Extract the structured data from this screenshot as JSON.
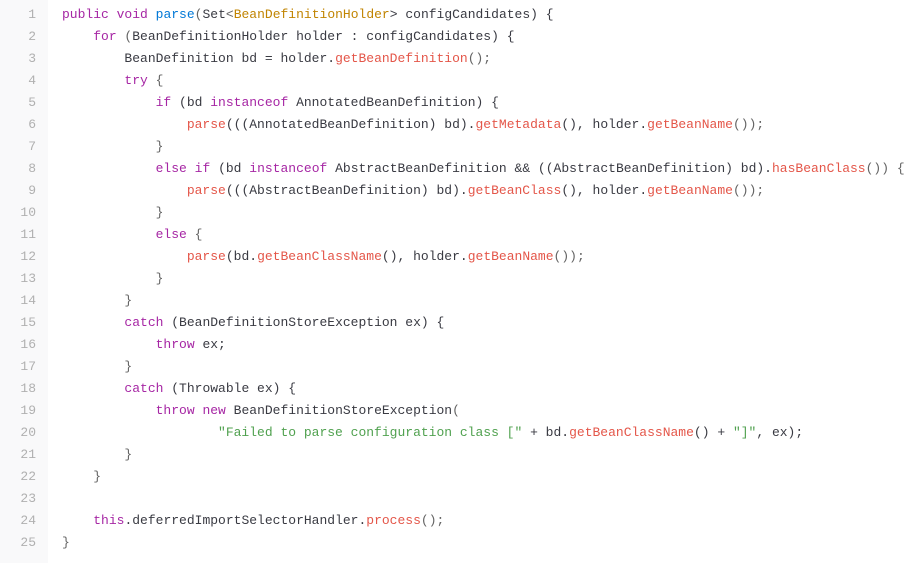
{
  "lines": [
    {
      "n": "1",
      "tokens": [
        {
          "t": "public",
          "c": "kw"
        },
        {
          "t": " ",
          "c": "punc"
        },
        {
          "t": "void",
          "c": "kw"
        },
        {
          "t": " ",
          "c": "punc"
        },
        {
          "t": "parse",
          "c": "method"
        },
        {
          "t": "(",
          "c": "punc"
        },
        {
          "t": "Set",
          "c": "var"
        },
        {
          "t": "<",
          "c": "punc"
        },
        {
          "t": "BeanDefinitionHolder",
          "c": "type"
        },
        {
          "t": "> configCandidates) {",
          "c": "var"
        }
      ]
    },
    {
      "n": "2",
      "tokens": [
        {
          "t": "    ",
          "c": "punc"
        },
        {
          "t": "for",
          "c": "kw"
        },
        {
          "t": " (",
          "c": "punc"
        },
        {
          "t": "BeanDefinitionHolder",
          "c": "var"
        },
        {
          "t": " holder : configCandidates) {",
          "c": "var"
        }
      ]
    },
    {
      "n": "3",
      "tokens": [
        {
          "t": "        ",
          "c": "punc"
        },
        {
          "t": "BeanDefinition",
          "c": "var"
        },
        {
          "t": " bd = holder.",
          "c": "var"
        },
        {
          "t": "getBeanDefinition",
          "c": "call"
        },
        {
          "t": "();",
          "c": "punc"
        }
      ]
    },
    {
      "n": "4",
      "tokens": [
        {
          "t": "        ",
          "c": "punc"
        },
        {
          "t": "try",
          "c": "kw"
        },
        {
          "t": " {",
          "c": "punc"
        }
      ]
    },
    {
      "n": "5",
      "tokens": [
        {
          "t": "            ",
          "c": "punc"
        },
        {
          "t": "if",
          "c": "kw"
        },
        {
          "t": " (bd ",
          "c": "var"
        },
        {
          "t": "instanceof",
          "c": "kw"
        },
        {
          "t": " AnnotatedBeanDefinition) {",
          "c": "var"
        }
      ]
    },
    {
      "n": "6",
      "tokens": [
        {
          "t": "                ",
          "c": "punc"
        },
        {
          "t": "parse",
          "c": "call"
        },
        {
          "t": "(((AnnotatedBeanDefinition) bd).",
          "c": "var"
        },
        {
          "t": "getMetadata",
          "c": "call"
        },
        {
          "t": "(), holder.",
          "c": "var"
        },
        {
          "t": "getBeanName",
          "c": "call"
        },
        {
          "t": "());",
          "c": "punc"
        }
      ]
    },
    {
      "n": "7",
      "tokens": [
        {
          "t": "            }",
          "c": "punc"
        }
      ]
    },
    {
      "n": "8",
      "tokens": [
        {
          "t": "            ",
          "c": "punc"
        },
        {
          "t": "else",
          "c": "kw"
        },
        {
          "t": " ",
          "c": "punc"
        },
        {
          "t": "if",
          "c": "kw"
        },
        {
          "t": " (bd ",
          "c": "var"
        },
        {
          "t": "instanceof",
          "c": "kw"
        },
        {
          "t": " AbstractBeanDefinition && ((AbstractBeanDefinition) bd).",
          "c": "var"
        },
        {
          "t": "hasBeanClass",
          "c": "call"
        },
        {
          "t": "()) {",
          "c": "punc"
        }
      ]
    },
    {
      "n": "9",
      "tokens": [
        {
          "t": "                ",
          "c": "punc"
        },
        {
          "t": "parse",
          "c": "call"
        },
        {
          "t": "(((AbstractBeanDefinition) bd).",
          "c": "var"
        },
        {
          "t": "getBeanClass",
          "c": "call"
        },
        {
          "t": "(), holder.",
          "c": "var"
        },
        {
          "t": "getBeanName",
          "c": "call"
        },
        {
          "t": "());",
          "c": "punc"
        }
      ]
    },
    {
      "n": "10",
      "tokens": [
        {
          "t": "            }",
          "c": "punc"
        }
      ]
    },
    {
      "n": "11",
      "tokens": [
        {
          "t": "            ",
          "c": "punc"
        },
        {
          "t": "else",
          "c": "kw"
        },
        {
          "t": " {",
          "c": "punc"
        }
      ]
    },
    {
      "n": "12",
      "tokens": [
        {
          "t": "                ",
          "c": "punc"
        },
        {
          "t": "parse",
          "c": "call"
        },
        {
          "t": "(bd.",
          "c": "var"
        },
        {
          "t": "getBeanClassName",
          "c": "call"
        },
        {
          "t": "(), holder.",
          "c": "var"
        },
        {
          "t": "getBeanName",
          "c": "call"
        },
        {
          "t": "());",
          "c": "punc"
        }
      ]
    },
    {
      "n": "13",
      "tokens": [
        {
          "t": "            }",
          "c": "punc"
        }
      ]
    },
    {
      "n": "14",
      "tokens": [
        {
          "t": "        }",
          "c": "punc"
        }
      ]
    },
    {
      "n": "15",
      "tokens": [
        {
          "t": "        ",
          "c": "punc"
        },
        {
          "t": "catch",
          "c": "kw"
        },
        {
          "t": " (BeanDefinitionStoreException ex) {",
          "c": "var"
        }
      ]
    },
    {
      "n": "16",
      "tokens": [
        {
          "t": "            ",
          "c": "punc"
        },
        {
          "t": "throw",
          "c": "kw"
        },
        {
          "t": " ex;",
          "c": "var"
        }
      ]
    },
    {
      "n": "17",
      "tokens": [
        {
          "t": "        }",
          "c": "punc"
        }
      ]
    },
    {
      "n": "18",
      "tokens": [
        {
          "t": "        ",
          "c": "punc"
        },
        {
          "t": "catch",
          "c": "kw"
        },
        {
          "t": " (Throwable ex) {",
          "c": "var"
        }
      ]
    },
    {
      "n": "19",
      "tokens": [
        {
          "t": "            ",
          "c": "punc"
        },
        {
          "t": "throw",
          "c": "kw"
        },
        {
          "t": " ",
          "c": "punc"
        },
        {
          "t": "new",
          "c": "kw"
        },
        {
          "t": " ",
          "c": "punc"
        },
        {
          "t": "BeanDefinitionStoreException",
          "c": "var"
        },
        {
          "t": "(",
          "c": "punc"
        }
      ]
    },
    {
      "n": "20",
      "tokens": [
        {
          "t": "                    ",
          "c": "punc"
        },
        {
          "t": "\"Failed to parse configuration class [\"",
          "c": "str"
        },
        {
          "t": " + bd.",
          "c": "var"
        },
        {
          "t": "getBeanClassName",
          "c": "call"
        },
        {
          "t": "() + ",
          "c": "var"
        },
        {
          "t": "\"]\"",
          "c": "str"
        },
        {
          "t": ", ex);",
          "c": "var"
        }
      ]
    },
    {
      "n": "21",
      "tokens": [
        {
          "t": "        }",
          "c": "punc"
        }
      ]
    },
    {
      "n": "22",
      "tokens": [
        {
          "t": "    }",
          "c": "punc"
        }
      ]
    },
    {
      "n": "23",
      "tokens": [
        {
          "t": "",
          "c": "punc"
        }
      ]
    },
    {
      "n": "24",
      "tokens": [
        {
          "t": "    ",
          "c": "punc"
        },
        {
          "t": "this",
          "c": "kw"
        },
        {
          "t": ".deferredImportSelectorHandler.",
          "c": "var"
        },
        {
          "t": "process",
          "c": "call"
        },
        {
          "t": "();",
          "c": "punc"
        }
      ]
    },
    {
      "n": "25",
      "tokens": [
        {
          "t": "}",
          "c": "punc"
        }
      ]
    }
  ]
}
